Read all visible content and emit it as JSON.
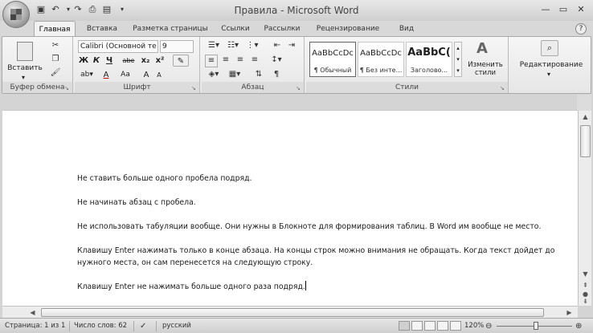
{
  "window": {
    "title": "Правила - Microsoft Word"
  },
  "qat_icons": [
    "save-icon",
    "undo-icon",
    "redo-icon",
    "print-icon",
    "quick-print-icon",
    "customize-qat-icon"
  ],
  "tabs": [
    {
      "label": "Главная",
      "active": true
    },
    {
      "label": "Вставка"
    },
    {
      "label": "Разметка страницы"
    },
    {
      "label": "Ссылки"
    },
    {
      "label": "Рассылки"
    },
    {
      "label": "Рецензирование"
    },
    {
      "label": "Вид"
    }
  ],
  "ribbon": {
    "clipboard": {
      "label": "Буфер обмена",
      "paste_label": "Вставить"
    },
    "font": {
      "label": "Шрифт",
      "font_name": "Calibri (Основной те",
      "font_size": "9",
      "buttons": [
        "Ж",
        "К",
        "Ч",
        "abe",
        "x₂",
        "x²",
        "Aa",
        "A",
        "A",
        "A"
      ]
    },
    "paragraph": {
      "label": "Абзац"
    },
    "styles": {
      "label": "Стили",
      "items": [
        {
          "sample": "AaBbCcDc",
          "name": "¶ Обычный"
        },
        {
          "sample": "AaBbCcDc",
          "name": "¶ Без инте..."
        },
        {
          "sample": "AaBbC(",
          "name": "Заголово..."
        }
      ],
      "change_styles_label": "Изменить стили"
    },
    "editing": {
      "label": "Редактирование"
    }
  },
  "document": {
    "paragraphs": [
      "Не ставить больше одного пробела подряд.",
      "Не начинать абзац с пробела.",
      "Не использовать табуляции вообще. Они нужны в Блокноте для формирования таблиц. В Word им вообще не место.",
      "Клавишу Enter нажимать только в конце абзаца. На концы строк можно внимания не обращать. Когда текст дойдет до нужного места, он сам перенесется на следующую строку.",
      "Клавишу Enter не нажимать больше одного раза подряд."
    ]
  },
  "status": {
    "page": "Страница: 1 из 1",
    "words": "Число слов: 62",
    "language": "русский",
    "zoom": "120%"
  }
}
